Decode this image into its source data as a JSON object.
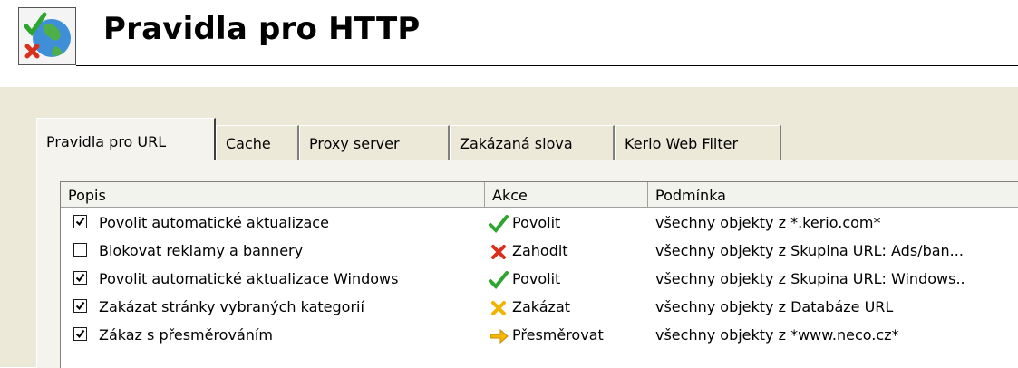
{
  "header": {
    "title": "Pravidla pro HTTP",
    "logo_icon": "globe-allow-deny-icon"
  },
  "tabs": [
    {
      "label": "Pravidla pro URL",
      "active": true
    },
    {
      "label": "Cache",
      "active": false
    },
    {
      "label": "Proxy server",
      "active": false
    },
    {
      "label": "Zakázaná slova",
      "active": false
    },
    {
      "label": "Kerio Web Filter",
      "active": false
    }
  ],
  "columns": {
    "description": "Popis",
    "action": "Akce",
    "condition": "Podmínka"
  },
  "rules": [
    {
      "checked": true,
      "description": "Povolit automatické aktualizace",
      "action": "Povolit",
      "action_icon": "green-check-icon",
      "condition": "všechny objekty z *.kerio.com*"
    },
    {
      "checked": false,
      "description": "Blokovat reklamy a bannery",
      "action": "Zahodit",
      "action_icon": "red-x-icon",
      "condition": "všechny objekty z Skupina URL: Ads/ban..."
    },
    {
      "checked": true,
      "description": "Povolit automatické aktualizace Windows",
      "action": "Povolit",
      "action_icon": "green-check-icon",
      "condition": "všechny objekty z Skupina URL: Windows.."
    },
    {
      "checked": true,
      "description": "Zakázat stránky vybraných kategorií",
      "action": "Zakázat",
      "action_icon": "yellow-x-icon",
      "condition": "všechny objekty z Databáze URL"
    },
    {
      "checked": true,
      "description": "Zákaz s přesměrováním",
      "action": "Přesměrovat",
      "action_icon": "redirect-arrow-icon",
      "condition": "všechny objekty z *www.neco.cz*"
    }
  ],
  "colors": {
    "dialog_bg": "#ece9d8",
    "allow": "#2ea52e",
    "drop": "#d9301c",
    "deny": "#f0b400",
    "redirect": "#f5b800"
  }
}
